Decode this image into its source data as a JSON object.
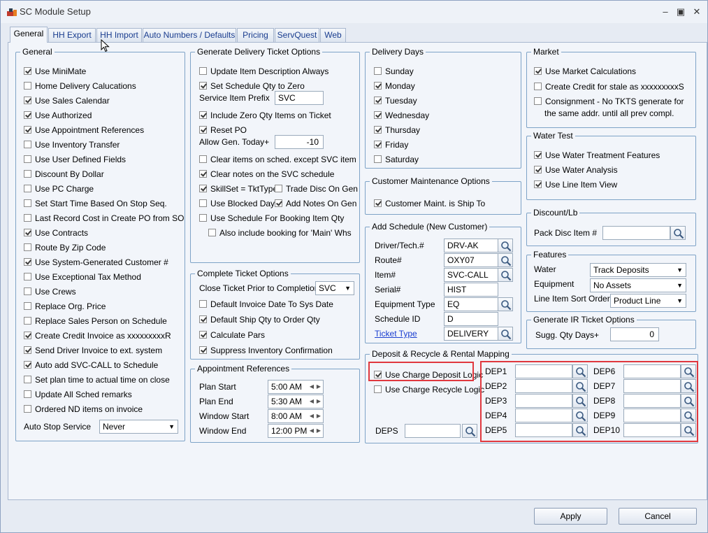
{
  "window": {
    "title": "SC Module Setup"
  },
  "tabs": [
    "General",
    "HH Export",
    "HH Import",
    "Auto Numbers / Defaults",
    "Pricing",
    "ServQuest",
    "Web"
  ],
  "general": {
    "title": "General",
    "items": [
      {
        "label": "Use MiniMate",
        "checked": true
      },
      {
        "label": "Home Delivery Calucations",
        "checked": false
      },
      {
        "label": "Use Sales Calendar",
        "checked": true
      },
      {
        "label": "Use Authorized",
        "checked": true
      },
      {
        "label": "Use Appointment References",
        "checked": true
      },
      {
        "label": "Use Inventory Transfer",
        "checked": false
      },
      {
        "label": "Use User Defined Fields",
        "checked": false
      },
      {
        "label": "Discount By Dollar",
        "checked": false
      },
      {
        "label": "Use PC Charge",
        "checked": false
      },
      {
        "label": "Set Start Time Based On Stop Seq.",
        "checked": false
      },
      {
        "label": "Last Record Cost in Create PO from SO",
        "checked": false
      },
      {
        "label": "Use Contracts",
        "checked": true
      },
      {
        "label": "Route By Zip Code",
        "checked": false
      },
      {
        "label": "Use System-Generated Customer #",
        "checked": true
      },
      {
        "label": "Use Exceptional Tax Method",
        "checked": false
      },
      {
        "label": "Use Crews",
        "checked": false
      },
      {
        "label": "Replace Org. Price",
        "checked": false
      },
      {
        "label": "Replace Sales Person on Schedule",
        "checked": false
      },
      {
        "label": "Create Credit Invoice as xxxxxxxxxR",
        "checked": true
      },
      {
        "label": "Send Driver Invoice to ext. system",
        "checked": true
      },
      {
        "label": "Auto add SVC-CALL to Schedule",
        "checked": true
      },
      {
        "label": "Set plan time to actual time on close",
        "checked": false
      },
      {
        "label": "Update All Sched remarks",
        "checked": false
      },
      {
        "label": "Ordered ND items on invoice",
        "checked": false
      }
    ],
    "auto_stop_label": "Auto Stop Service",
    "auto_stop_value": "Never"
  },
  "gen_delivery": {
    "title": "Generate Delivery Ticket Options",
    "update_item": {
      "label": "Update Item Description Always",
      "checked": false
    },
    "set_schedule": {
      "label": "Set Schedule Qty to Zero",
      "checked": true
    },
    "service_prefix_label": "Service Item Prefix",
    "service_prefix_value": "SVC",
    "include_zero": {
      "label": "Include Zero Qty Items on Ticket",
      "checked": true
    },
    "reset_po": {
      "label": "Reset PO",
      "checked": true
    },
    "allow_gen_label": "Allow Gen. Today+",
    "allow_gen_value": "-10",
    "clear_items": {
      "label": "Clear items on sched. except SVC item",
      "checked": false
    },
    "clear_notes": {
      "label": "Clear notes on the SVC schedule",
      "checked": true
    },
    "skillset": {
      "label": "SkillSet = TktType",
      "checked": true
    },
    "trade_disc": {
      "label": "Trade Disc On Gen",
      "checked": false
    },
    "use_blocked": {
      "label": "Use Blocked Days",
      "checked": false
    },
    "add_notes": {
      "label": "Add Notes On Gen",
      "checked": true
    },
    "use_schedule": {
      "label": "Use Schedule For Booking Item Qty",
      "checked": false
    },
    "also_include": {
      "label": "Also include booking for 'Main' Whs",
      "checked": false
    }
  },
  "complete_ticket": {
    "title": "Complete Ticket Options",
    "close_label": "Close Ticket Prior to Completion",
    "close_value": "SVC",
    "items": [
      {
        "label": "Default Invoice Date To Sys Date",
        "checked": false
      },
      {
        "label": "Default Ship Qty to Order Qty",
        "checked": true
      },
      {
        "label": "Calculate Pars",
        "checked": true
      },
      {
        "label": "Suppress Inventory Confirmation",
        "checked": true
      }
    ]
  },
  "appointment": {
    "title": "Appointment References",
    "rows": [
      {
        "label": "Plan Start",
        "value": "5:00 AM"
      },
      {
        "label": "Plan End",
        "value": "5:30 AM"
      },
      {
        "label": "Window Start",
        "value": "8:00 AM"
      },
      {
        "label": "Window End",
        "value": "12:00 PM"
      }
    ]
  },
  "delivery_days": {
    "title": "Delivery Days",
    "days": [
      {
        "label": "Sunday",
        "checked": false
      },
      {
        "label": "Monday",
        "checked": true
      },
      {
        "label": "Tuesday",
        "checked": true
      },
      {
        "label": "Wednesday",
        "checked": true
      },
      {
        "label": "Thursday",
        "checked": true
      },
      {
        "label": "Friday",
        "checked": true
      },
      {
        "label": "Saturday",
        "checked": false
      }
    ]
  },
  "customer_maint": {
    "title": "Customer Maintenance Options",
    "item": {
      "label": "Customer Maint. is Ship To",
      "checked": true
    }
  },
  "add_schedule": {
    "title": "Add Schedule (New Customer)",
    "rows": [
      {
        "label": "Driver/Tech.#",
        "value": "DRV-AK"
      },
      {
        "label": "Route#",
        "value": "OXY07"
      },
      {
        "label": "Item#",
        "value": "SVC-CALL"
      },
      {
        "label": "Serial#",
        "value": "HIST"
      },
      {
        "label": "Equipment Type",
        "value": "EQ"
      },
      {
        "label": "Schedule ID",
        "value": "D"
      },
      {
        "label": "Ticket Type",
        "value": "DELIVERY"
      }
    ]
  },
  "deposit": {
    "title": "Deposit & Recycle & Rental Mapping",
    "use_charge_deposit": {
      "label": "Use Charge Deposit Logic",
      "checked": true
    },
    "use_charge_recycle": {
      "label": "Use Charge Recycle Logic",
      "checked": false
    },
    "deps_label": "DEPS",
    "deps_value": "",
    "deps": [
      "DEP1",
      "DEP2",
      "DEP3",
      "DEP4",
      "DEP5",
      "DEP6",
      "DEP7",
      "DEP8",
      "DEP9",
      "DEP10"
    ]
  },
  "market": {
    "title": "Market",
    "use_market": {
      "label": "Use Market Calculations",
      "checked": true
    },
    "create_credit": {
      "label": "Create Credit for stale as xxxxxxxxxS",
      "checked": false
    },
    "consignment": {
      "label": "Consignment - No TKTS generate for",
      "label2": "the same addr. until all prev compl.",
      "checked": false
    }
  },
  "water_test": {
    "title": "Water Test",
    "items": [
      {
        "label": "Use Water Treatment Features",
        "checked": true
      },
      {
        "label": "Use Water Analysis",
        "checked": true
      },
      {
        "label": "Use Line Item View",
        "checked": true
      }
    ]
  },
  "discount": {
    "title": "Discount/Lb",
    "pack_label": "Pack Disc Item #",
    "pack_value": ""
  },
  "features": {
    "title": "Features",
    "rows": [
      {
        "label": "Water",
        "value": "Track Deposits"
      },
      {
        "label": "Equipment",
        "value": "No Assets"
      },
      {
        "label": "Line Item Sort Order",
        "value": "Product Line"
      }
    ]
  },
  "ir_ticket": {
    "title": "Generate IR Ticket Options",
    "sugg_label": "Sugg. Qty Days+",
    "sugg_value": "0"
  },
  "buttons": {
    "apply": "Apply",
    "cancel": "Cancel"
  },
  "colors": {
    "group_border": "#7ea3c7",
    "highlight": "#e0383e",
    "tab_text": "#1a3d8f",
    "link": "#1a3ed0"
  },
  "icons": {
    "lookup": "magnifier-icon",
    "app": "app-icon",
    "minimize": "minimize-icon",
    "maximize": "maximize-icon",
    "close": "close-icon"
  }
}
